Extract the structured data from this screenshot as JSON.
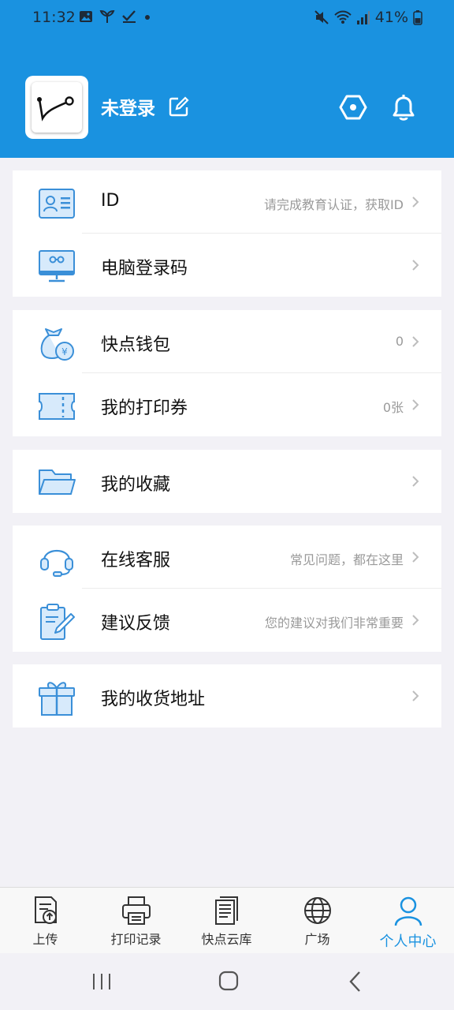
{
  "status_bar": {
    "time": "11:32",
    "battery": "41%"
  },
  "profile": {
    "username": "未登录"
  },
  "colors": {
    "brand": "#1a92e0",
    "chevron": "#bdbdbd",
    "value_text": "#9a9a9a"
  },
  "menu": {
    "id": {
      "label": "ID",
      "value": "请完成教育认证，获取ID"
    },
    "pc_login": {
      "label": "电脑登录码",
      "value": ""
    },
    "wallet": {
      "label": "快点钱包",
      "value": "0"
    },
    "coupons": {
      "label": "我的打印券",
      "value": "0张"
    },
    "favorites": {
      "label": "我的收藏",
      "value": ""
    },
    "service": {
      "label": "在线客服",
      "value": "常见问题，都在这里"
    },
    "feedback": {
      "label": "建议反馈",
      "value": "您的建议对我们非常重要"
    },
    "address": {
      "label": "我的收货地址",
      "value": ""
    }
  },
  "tabs": {
    "upload": "上传",
    "records": "打印记录",
    "library": "快点云库",
    "square": "广场",
    "me": "个人中心"
  },
  "icons": [
    "image-icon",
    "leaf-icon",
    "check-icon",
    "mute-icon",
    "wifi-icon",
    "signal-icon",
    "battery-icon",
    "edit-icon",
    "settings-hex-icon",
    "bell-icon",
    "id-card-icon",
    "monitor-icon",
    "money-bag-icon",
    "ticket-icon",
    "folder-icon",
    "headset-icon",
    "clipboard-pen-icon",
    "gift-icon",
    "upload-doc-icon",
    "printer-icon",
    "documents-icon",
    "globe-icon",
    "person-icon"
  ]
}
